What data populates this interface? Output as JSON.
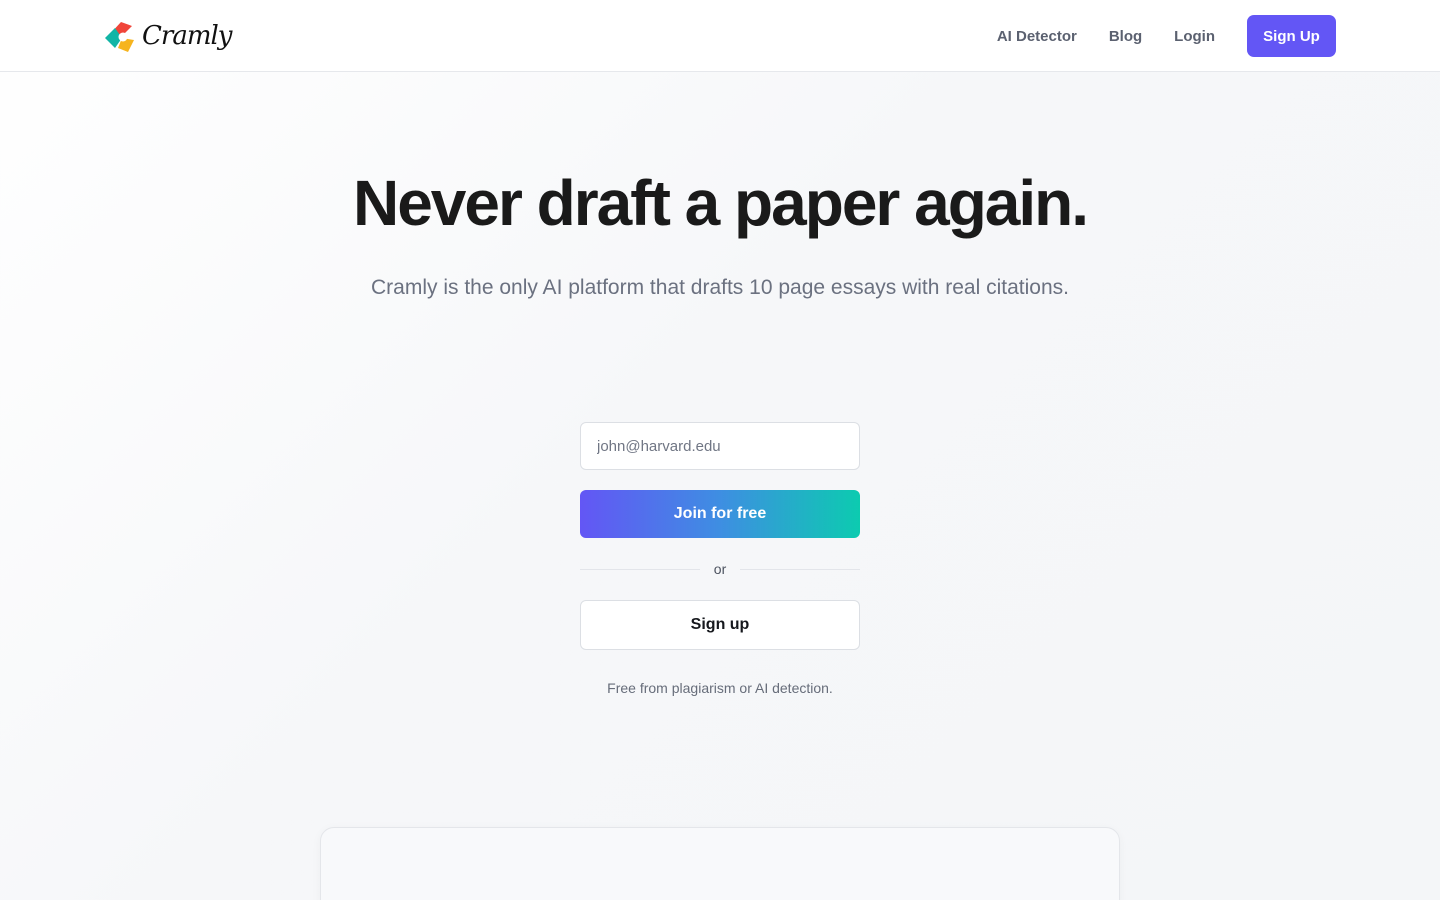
{
  "brand": {
    "name": "Cramly",
    "colors": {
      "red": "#f0453a",
      "teal": "#12b5a6",
      "yellow": "#f6b41e",
      "primary": "#6356f5"
    }
  },
  "header": {
    "nav": [
      {
        "label": "AI Detector"
      },
      {
        "label": "Blog"
      },
      {
        "label": "Login"
      }
    ],
    "signup_label": "Sign Up"
  },
  "hero": {
    "title": "Never draft a paper again.",
    "subtitle": "Cramly is the only AI platform that drafts 10 page essays with real citations."
  },
  "form": {
    "email_placeholder": "john@harvard.edu",
    "join_label": "Join for free",
    "divider_text": "or",
    "signup_label": "Sign up",
    "disclaimer": "Free from plagiarism or AI detection.",
    "join_gradient": [
      "#6356f5",
      "#0ccbb0"
    ]
  },
  "icons": {
    "logo": "cramly-logo-icon"
  }
}
